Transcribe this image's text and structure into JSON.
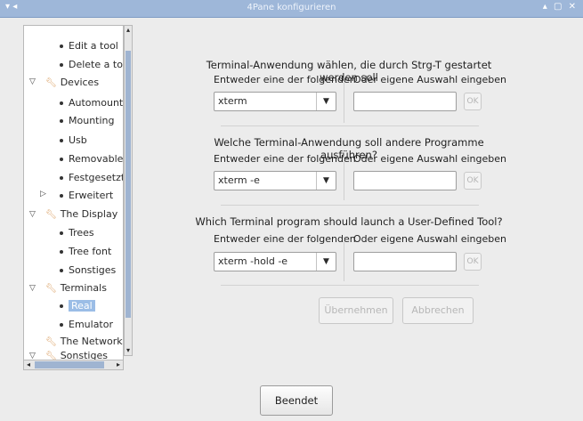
{
  "window": {
    "title": "4Pane konfigurieren",
    "left_controls": "▾ ◂",
    "right_controls": "▴ ▢ ✕"
  },
  "tree": {
    "items": [
      {
        "label": "Edit a tool"
      },
      {
        "label": "Delete a too"
      },
      {
        "label": "Devices"
      },
      {
        "label": "Automount"
      },
      {
        "label": "Mounting"
      },
      {
        "label": "Usb"
      },
      {
        "label": "Removable"
      },
      {
        "label": "Festgesetzt"
      },
      {
        "label": "Erweitert"
      },
      {
        "label": "The Display"
      },
      {
        "label": "Trees"
      },
      {
        "label": "Tree font"
      },
      {
        "label": "Sonstiges"
      },
      {
        "label": "Terminals"
      },
      {
        "label": "Real"
      },
      {
        "label": "Emulator"
      },
      {
        "label": "The Network"
      },
      {
        "label": "Sonstiges"
      }
    ]
  },
  "sections": [
    {
      "title": "Terminal-Anwendung wählen, die durch Strg-T gestartet werden soll",
      "left_label": "Entweder eine der folgenden",
      "right_label": "Oder eigene Auswahl eingeben",
      "selected": "xterm",
      "ok": "OK"
    },
    {
      "title": "Welche Terminal-Anwendung soll andere Programme ausführen?",
      "left_label": "Entweder eine der folgenden",
      "right_label": "Oder eigene Auswahl eingeben",
      "selected": "xterm -e",
      "ok": "OK"
    },
    {
      "title": "Which Terminal program should launch a User-Defined Tool?",
      "left_label": "Entweder eine der folgenden",
      "right_label": "Oder eigene Auswahl eingeben",
      "selected": "xterm -hold -e",
      "ok": "OK"
    }
  ],
  "buttons": {
    "apply": "Übernehmen",
    "cancel": "Abbrechen",
    "done": "Beendet"
  },
  "colors": {
    "titlebar": "#9eb7d9",
    "selection": "#9bbde6",
    "scroll_thumb": "#9fb4d1"
  }
}
